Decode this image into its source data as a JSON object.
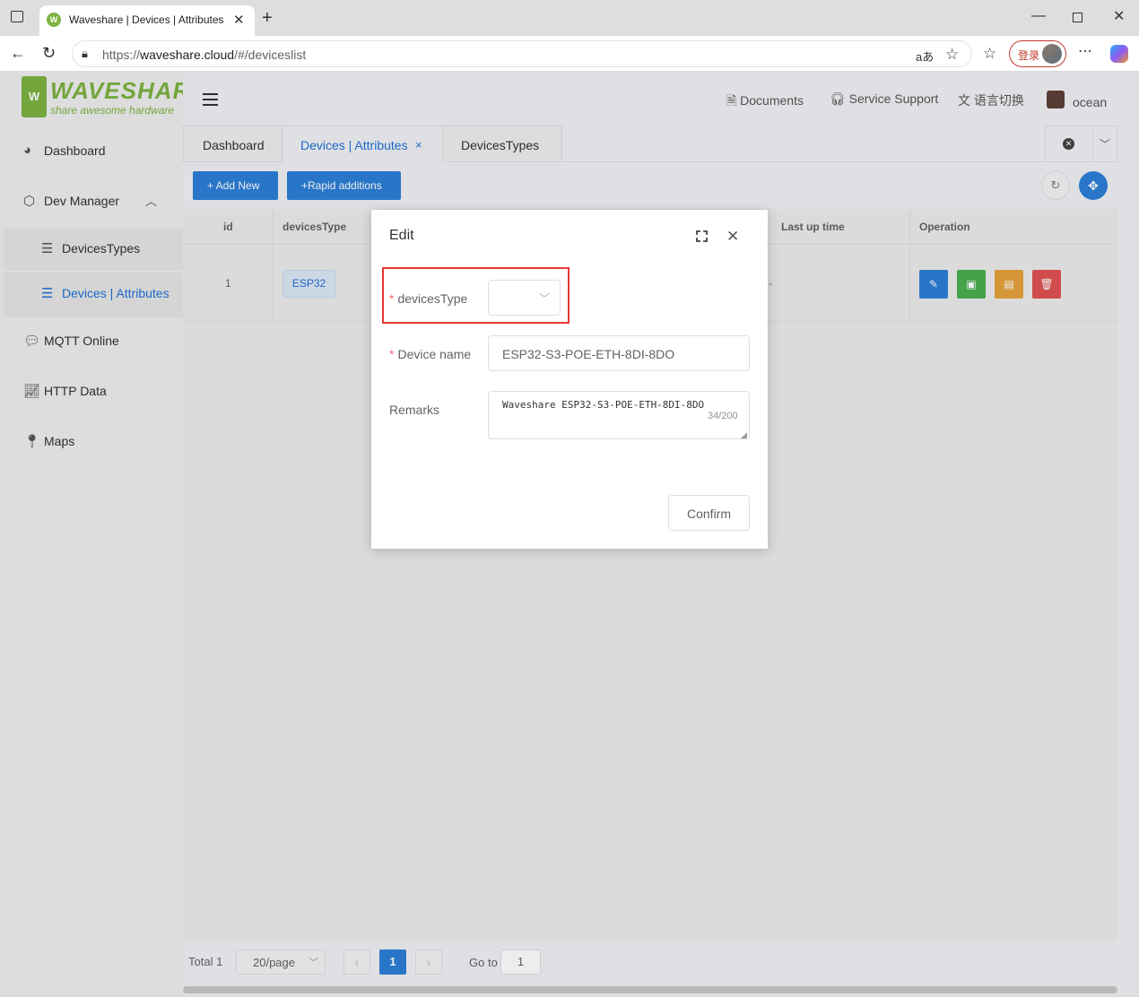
{
  "browser": {
    "tab_title": "Waveshare | Devices | Attributes",
    "favicon_text": "W",
    "url_prefix": "https://",
    "url_host": "waveshare.cloud",
    "url_path": "/#/deviceslist",
    "read_aloud_label": "aあ",
    "login_label": "登录"
  },
  "logo": {
    "mark": "W",
    "brand": "WAVESHARE",
    "tagline": "share awesome hardware"
  },
  "sidebar": {
    "items": [
      {
        "label": "Dashboard"
      },
      {
        "label": "Dev Manager"
      },
      {
        "label": "DevicesTypes"
      },
      {
        "label": "Devices | Attributes"
      },
      {
        "label": "MQTT Online"
      },
      {
        "label": "HTTP Data"
      },
      {
        "label": "Maps"
      }
    ]
  },
  "header": {
    "documents": "Documents",
    "support": "Service Support",
    "language": "语言切换",
    "user": "ocean"
  },
  "page_tabs": [
    {
      "label": "Dashboard"
    },
    {
      "label": "Devices | Attributes",
      "close": "×"
    },
    {
      "label": "DevicesTypes"
    }
  ],
  "toolbar": {
    "add_new": "+ Add New",
    "rapid": "+Rapid additions"
  },
  "table": {
    "headers": [
      "id",
      "devicesType",
      "Last up time",
      "Operation"
    ],
    "rows": [
      {
        "id": "1",
        "devicesType": "ESP32",
        "last_up_time": "-"
      }
    ]
  },
  "pagination": {
    "total": "Total 1",
    "page_size": "20/page",
    "current_page": "1",
    "goto_label": "Go to",
    "goto_value": "1"
  },
  "dialog": {
    "title": "Edit",
    "required_mark": "*",
    "devicestype_label": "devicesType",
    "devicestype_value": "",
    "device_name_label": "Device name",
    "device_name_value": "ESP32-S3-POE-ETH-8DI-8DO",
    "remarks_label": "Remarks",
    "remarks_value": "Waveshare ESP32-S3-POE-ETH-8DI-8DO",
    "remarks_counter": "34/200",
    "confirm": "Confirm"
  },
  "colors": {
    "primary": "#2d7fd9",
    "success": "#4caf50",
    "warning": "#e6a23c",
    "danger": "#e05252",
    "brand_green": "#7cb342",
    "highlight_red": "#e53935"
  },
  "icons": [
    "window-icon",
    "favicon-icon",
    "close-tab-icon",
    "new-tab-icon",
    "minimize-icon",
    "maximize-icon",
    "close-window-icon",
    "back-icon",
    "refresh-icon",
    "site-info-icon",
    "read-aloud-icon",
    "favorite-star-icon",
    "favorites-icon",
    "more-icon",
    "copilot-icon",
    "hamburger-icon",
    "document-icon",
    "headset-icon",
    "translate-icon",
    "pie-chart-icon",
    "hexagon-icon",
    "list-icon",
    "chat-icon",
    "line-chart-icon",
    "location-pin-icon",
    "edit-icon",
    "save-icon",
    "document-icon",
    "trash-icon",
    "refresh-circle-icon",
    "move-icon",
    "fullscreen-icon",
    "chevron-down-icon"
  ]
}
